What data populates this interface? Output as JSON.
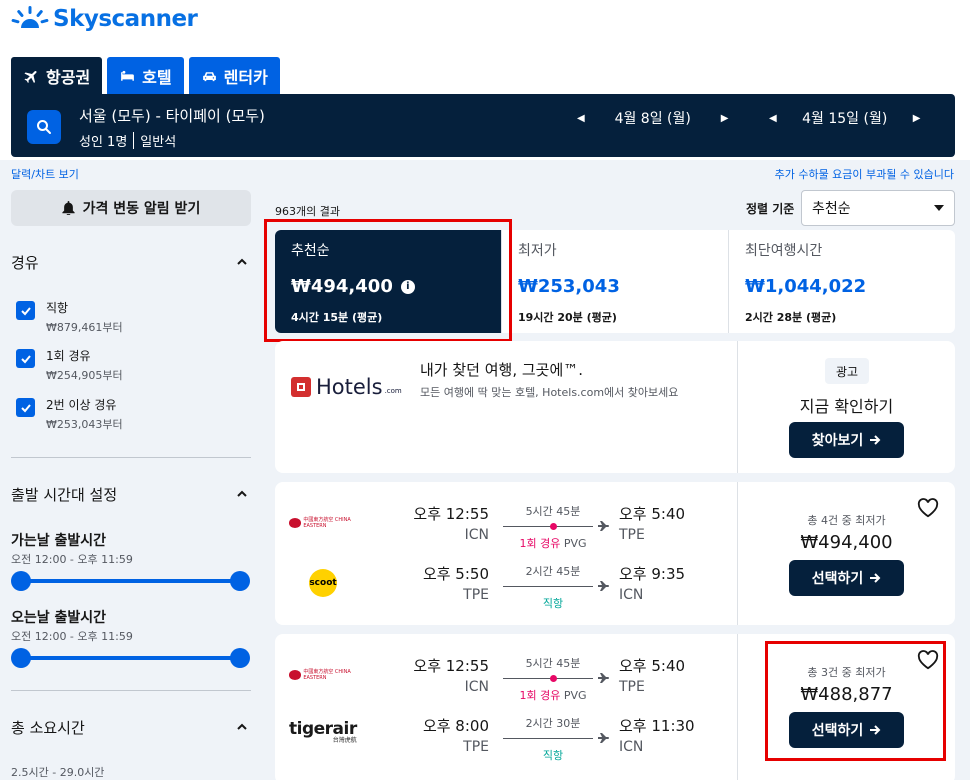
{
  "brand": {
    "name": "Skyscanner",
    "color": "#0770e3"
  },
  "tabs": [
    {
      "label": "항공권",
      "icon": "plane-icon",
      "active": true
    },
    {
      "label": "호텔",
      "icon": "bed-icon",
      "active": false
    },
    {
      "label": "렌터카",
      "icon": "car-icon",
      "active": false
    }
  ],
  "search": {
    "route": "서울 (모두) - 타이페이 (모두)",
    "passengers": "성인 1명",
    "cabin": "일반석",
    "depart_date": "4월 8일 (월)",
    "return_date": "4월 15일 (월)"
  },
  "links": {
    "calendar": "달력/차트 보기",
    "extra_fees": "추가 수하물 요금이 부과될 수 있습니다"
  },
  "sidebar": {
    "alert_button": "가격 변동 알림 받기",
    "stops": {
      "title": "경유",
      "options": [
        {
          "label": "직항",
          "price": "₩879,461부터",
          "checked": true
        },
        {
          "label": "1회 경유",
          "price": "₩254,905부터",
          "checked": true
        },
        {
          "label": "2번 이상 경유",
          "price": "₩253,043부터",
          "checked": true
        }
      ]
    },
    "departure_times": {
      "title": "출발 시간대 설정",
      "outbound_title": "가는날 출발시간",
      "outbound_range": "오전 12:00 - 오후 11:59",
      "inbound_title": "오는날 출발시간",
      "inbound_range": "오전 12:00 - 오후 11:59"
    },
    "duration": {
      "title": "총 소요시간",
      "range": "2.5시간 - 29.0시간"
    }
  },
  "results": {
    "count": "963개의 결과",
    "sort_label": "정렬 기준",
    "sort_value": "추천순",
    "sort_tabs": [
      {
        "name": "추천순",
        "price": "₩494,400",
        "duration": "4시간 15분 (평균)",
        "active": true
      },
      {
        "name": "최저가",
        "price": "₩253,043",
        "duration": "19시간 20분 (평균)",
        "active": false
      },
      {
        "name": "최단여행시간",
        "price": "₩1,044,022",
        "duration": "2시간 28분 (평균)",
        "active": false
      }
    ]
  },
  "ad": {
    "brand": "Hotels",
    "brand_domain": ".com",
    "title": "내가 찾던 여행, 그곳에™.",
    "description": "모든 여행에 딱 맞는 호텔, Hotels.com에서 찾아보세요",
    "badge": "광고",
    "cta_text": "지금 확인하기",
    "button": "찾아보기"
  },
  "flights": [
    {
      "legs": [
        {
          "airline": "China Eastern",
          "dep_time": "오후 12:55",
          "dep_code": "ICN",
          "duration": "5시간 45분",
          "stops": "1회 경유",
          "via": "PVG",
          "arr_time": "오후 5:40",
          "arr_code": "TPE"
        },
        {
          "airline": "Scoot",
          "dep_time": "오후 5:50",
          "dep_code": "TPE",
          "duration": "2시간 45분",
          "stops": "직항",
          "via": "",
          "arr_time": "오후 9:35",
          "arr_code": "ICN"
        }
      ],
      "deals": "총 4건 중 최저가",
      "price": "₩494,400",
      "button": "선택하기"
    },
    {
      "legs": [
        {
          "airline": "China Eastern",
          "dep_time": "오후 12:55",
          "dep_code": "ICN",
          "duration": "5시간 45분",
          "stops": "1회 경유",
          "via": "PVG",
          "arr_time": "오후 5:40",
          "arr_code": "TPE"
        },
        {
          "airline": "tigerair",
          "dep_time": "오후 8:00",
          "dep_code": "TPE",
          "duration": "2시간 30분",
          "stops": "직항",
          "via": "",
          "arr_time": "오후 11:30",
          "arr_code": "ICN"
        }
      ],
      "deals": "총 3건 중 최저가",
      "price": "₩488,877",
      "button": "선택하기"
    }
  ],
  "airline_logos": {
    "china_eastern": "中國東方航空 CHINA EASTERN",
    "scoot": "scoot",
    "tiger_main": "tigerair",
    "tiger_sub": "台灣虎航"
  },
  "colors": {
    "dark_navy": "#05203c",
    "accent_blue": "#0062e3",
    "highlight_red": "#e60000",
    "stop_pink": "#e70866",
    "direct_teal": "#00a698"
  }
}
